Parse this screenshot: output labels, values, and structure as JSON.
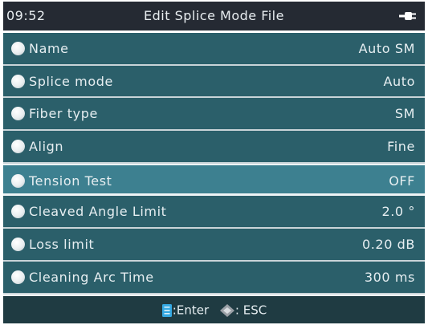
{
  "header": {
    "time": "09:52",
    "title": "Edit Splice Mode File",
    "power_icon": "plug-icon"
  },
  "settings": [
    {
      "label": "Name",
      "value": "Auto SM"
    },
    {
      "label": "Splice mode",
      "value": "Auto"
    },
    {
      "label": "Fiber type",
      "value": "SM"
    },
    {
      "label": "Align",
      "value": "Fine"
    },
    {
      "label": "Tension Test",
      "value": "OFF",
      "selected": true
    },
    {
      "label": "Cleaved Angle Limit",
      "value": "2.0 °"
    },
    {
      "label": "Loss limit",
      "value": "0.20 dB"
    },
    {
      "label": "Cleaning Arc Time",
      "value": "300 ms"
    }
  ],
  "footer": {
    "enter_label": ":Enter",
    "esc_label": ": ESC",
    "enter_icon": "enter-icon",
    "esc_icon": "esc-icon"
  },
  "colors": {
    "titlebar": "#252a33",
    "row": "#2b5f6a",
    "row_selected": "#3d8090",
    "footer": "#1f3b42",
    "enter_icon": "#35a9e3",
    "esc_icon": "#9aa0a6"
  }
}
